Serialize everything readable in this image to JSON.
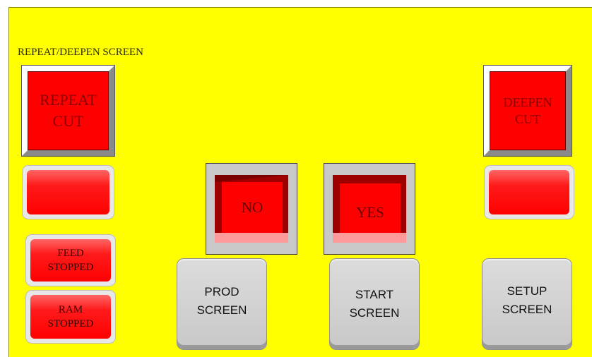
{
  "screen": {
    "title": "REPEAT/DEEPEN SCREEN"
  },
  "buttons": {
    "repeat_cut": "REPEAT\nCUT",
    "deepen_cut": "DEEPEN\nCUT",
    "no": "NO",
    "yes": "YES",
    "prod_screen": "PROD\nSCREEN",
    "start_screen": "START\nSCREEN",
    "setup_screen": "SETUP\nSCREEN"
  },
  "indicators": {
    "feed": "FEED\nSTOPPED",
    "ram": "RAM\nSTOPPED"
  },
  "colors": {
    "background": "#ffff00",
    "button_red": "#ff0000",
    "nav_grey": "#c8c8c8"
  }
}
